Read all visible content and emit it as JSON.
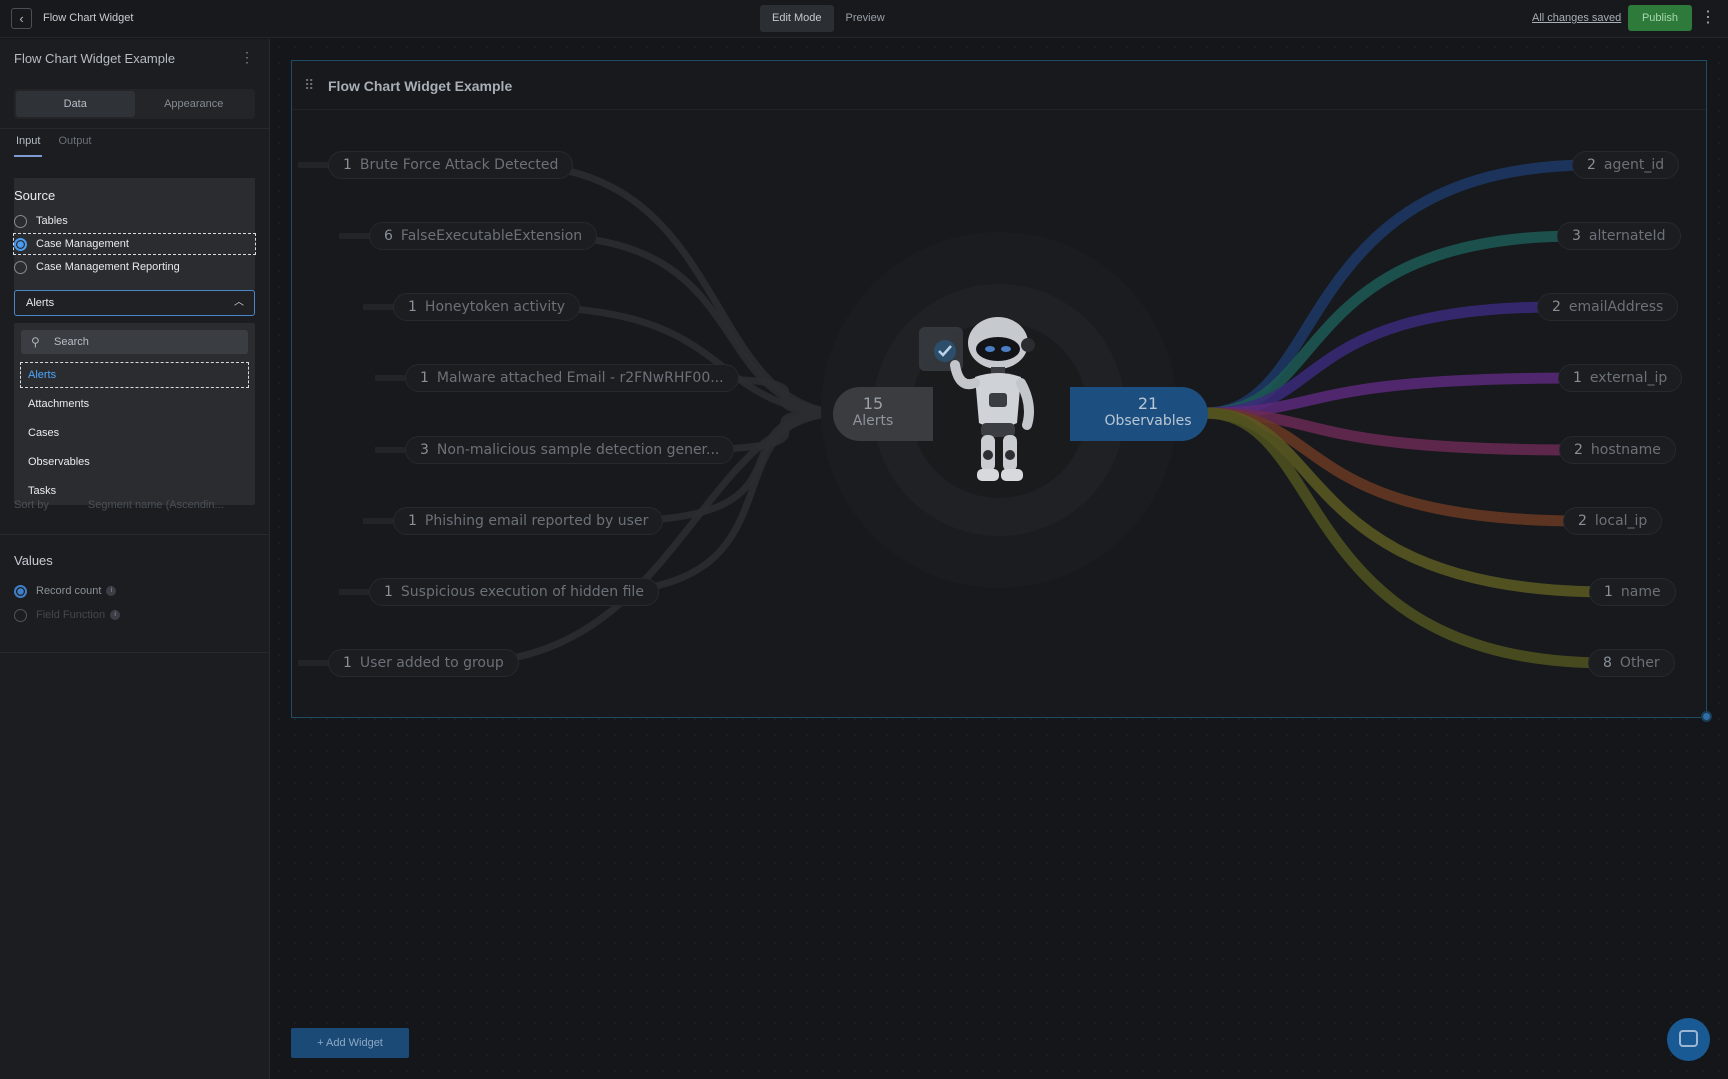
{
  "topbar": {
    "title": "Flow Chart Widget",
    "modes": [
      "Edit Mode",
      "Preview"
    ],
    "saved": "All changes saved",
    "publish": "Publish"
  },
  "sidebar": {
    "title": "Flow Chart Widget Example",
    "segments": [
      "Data",
      "Appearance"
    ],
    "subtabs": [
      "Input",
      "Output"
    ],
    "source_label": "Source",
    "source_options": [
      "Tables",
      "Case Management",
      "Case Management Reporting"
    ],
    "selected_source": "Case Management",
    "select_value": "Alerts",
    "search_placeholder": "Search",
    "dropdown_items": [
      "Alerts",
      "Attachments",
      "Cases",
      "Observables",
      "Tasks"
    ],
    "sort_by_label": "Sort by",
    "sort_by_value": "Segment name (Ascendin...",
    "values_label": "Values",
    "values_options": [
      "Record count",
      "Field Function"
    ]
  },
  "widget": {
    "title": "Flow Chart Widget Example",
    "left_hub": {
      "count": "15",
      "label": "Alerts"
    },
    "right_hub": {
      "count": "21",
      "label": "Observables"
    },
    "left_items": [
      {
        "count": "1",
        "label": "Brute Force Attack Detected"
      },
      {
        "count": "6",
        "label": "FalseExecutableExtension"
      },
      {
        "count": "1",
        "label": "Honeytoken activity"
      },
      {
        "count": "1",
        "label": "Malware attached Email - r2FNwRHF00..."
      },
      {
        "count": "3",
        "label": "Non-malicious sample detection gener..."
      },
      {
        "count": "1",
        "label": "Phishing email reported by user"
      },
      {
        "count": "1",
        "label": "Suspicious execution of hidden file"
      },
      {
        "count": "1",
        "label": "User added to group"
      }
    ],
    "right_items": [
      {
        "count": "2",
        "label": "agent_id",
        "color": "#1d3a66"
      },
      {
        "count": "3",
        "label": "alternateId",
        "color": "#1c5a55"
      },
      {
        "count": "2",
        "label": "emailAddress",
        "color": "#3b2a7a"
      },
      {
        "count": "1",
        "label": "external_ip",
        "color": "#5a2a7a"
      },
      {
        "count": "2",
        "label": "hostname",
        "color": "#6a2a55"
      },
      {
        "count": "2",
        "label": "local_ip",
        "color": "#6a3a22"
      },
      {
        "count": "1",
        "label": "name",
        "color": "#5a5a22"
      },
      {
        "count": "8",
        "label": "Other",
        "color": "#50521f"
      }
    ]
  },
  "add_widget": "+ Add Widget"
}
